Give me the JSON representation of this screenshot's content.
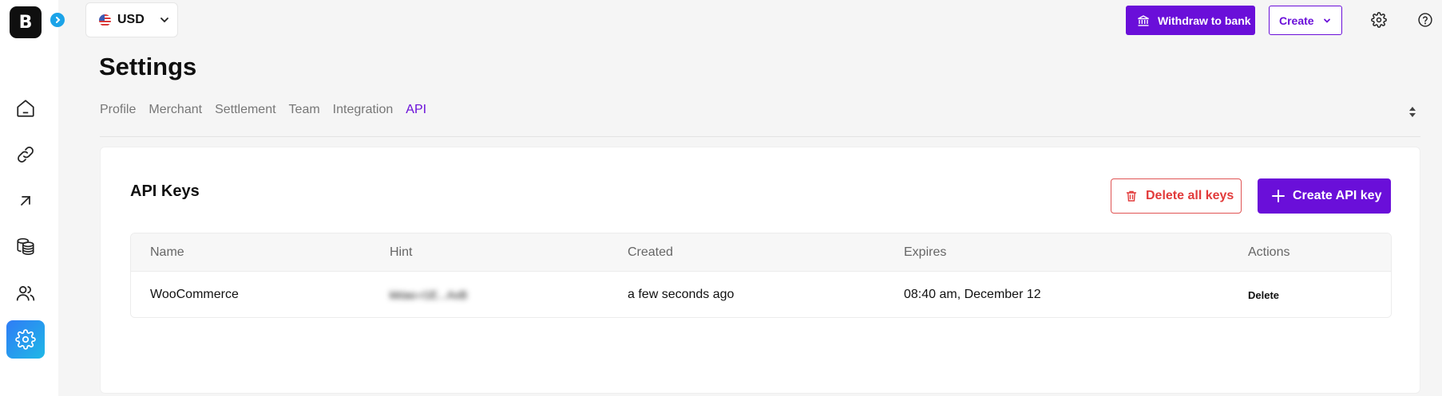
{
  "logo": {
    "letter": "B"
  },
  "currency": {
    "code": "USD",
    "flag": "us-flag"
  },
  "topbar": {
    "withdraw_label": "Withdraw to bank",
    "create_label": "Create"
  },
  "page": {
    "title": "Settings",
    "tabs": [
      {
        "label": "Profile",
        "active": false
      },
      {
        "label": "Merchant",
        "active": false
      },
      {
        "label": "Settlement",
        "active": false
      },
      {
        "label": "Team",
        "active": false
      },
      {
        "label": "Integration",
        "active": false
      },
      {
        "label": "API",
        "active": true
      }
    ]
  },
  "api_keys": {
    "title": "API Keys",
    "delete_all_label": "Delete all keys",
    "create_label": "Create API key",
    "columns": [
      "Name",
      "Hint",
      "Created",
      "Expires",
      "Actions"
    ],
    "rows": [
      {
        "name": "WooCommerce",
        "hint": "kktao-r1E...AxB",
        "created": "a few seconds ago",
        "expires": "08:40 am, December 12",
        "action": "Delete"
      }
    ]
  },
  "sidebar": {
    "items": [
      {
        "icon": "home-icon",
        "active": false
      },
      {
        "icon": "link-icon",
        "active": false
      },
      {
        "icon": "arrow-up-right-icon",
        "active": false
      },
      {
        "icon": "coins-icon",
        "active": false
      },
      {
        "icon": "users-icon",
        "active": false
      },
      {
        "icon": "settings-icon",
        "active": true
      }
    ]
  },
  "colors": {
    "accent": "#6a0fd9",
    "danger": "#e23b3b",
    "sidebar_active_start": "#2f7cf6",
    "sidebar_active_end": "#1fb8e6"
  }
}
